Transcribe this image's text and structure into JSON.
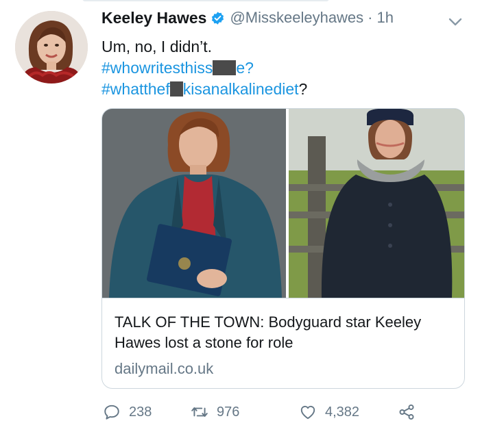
{
  "tweet": {
    "author_name": "Keeley Hawes",
    "author_handle": "@Misskeeleyhawes",
    "separator": "·",
    "timestamp": "1h",
    "text_line": "Um, no, I didn’t.",
    "hashtag1_start": "#whowritesthiss",
    "hashtag1_end": "e?",
    "hashtag2_start": "#whatthef",
    "hashtag2_end": "kisanalkalinediet",
    "hashtag2_suffix": "?"
  },
  "card": {
    "title_line1": "TALK OF THE TOWN: Bodyguard star Keeley",
    "title_line2": "Hawes lost a stone for role",
    "domain": "dailymail.co.uk"
  },
  "actions": {
    "replies": "238",
    "retweets": "976",
    "likes": "4,382"
  },
  "icons": {
    "verified": "verified-badge-icon",
    "menu": "chevron-down-icon",
    "reply": "reply-icon",
    "retweet": "retweet-icon",
    "like": "heart-icon",
    "share": "share-icon"
  },
  "colors": {
    "link": "#1b95e0",
    "secondary_text": "#657786",
    "border": "#ccd6dd",
    "verified": "#1da1f2"
  }
}
